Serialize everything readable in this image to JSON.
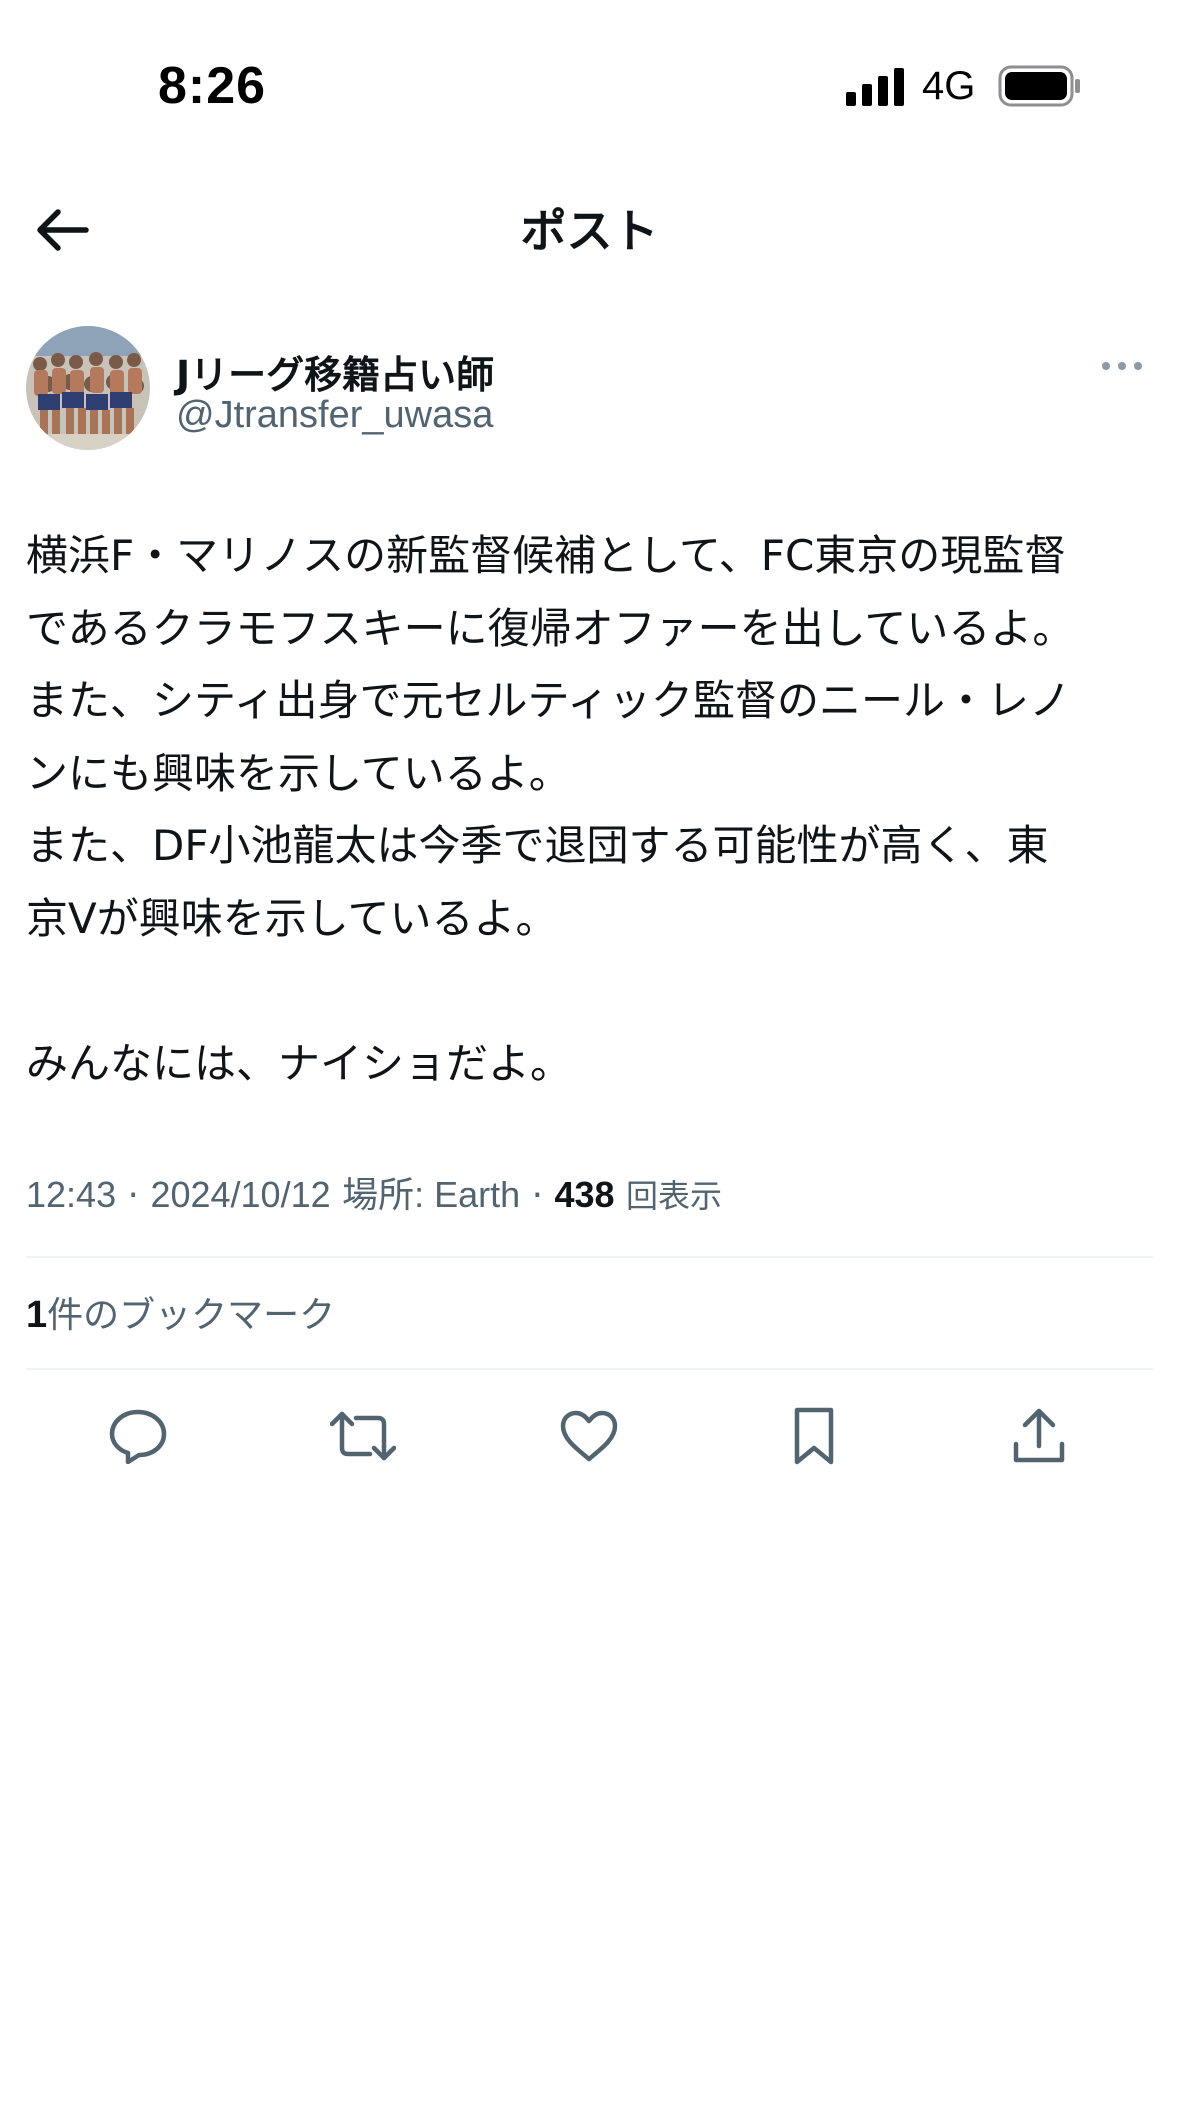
{
  "status_bar": {
    "time": "8:26",
    "network": "4G"
  },
  "header": {
    "title": "ポスト"
  },
  "author": {
    "display_name": "Jリーグ移籍占い師",
    "handle": "@Jtransfer_uwasa"
  },
  "post": {
    "lines": [
      "横浜F・マリノスの新監督候補として、FC東京の現監督",
      "であるクラモフスキーに復帰オファーを出しているよ。",
      "また、シティ出身で元セルティック監督のニール・レノ",
      "ンにも興味を示しているよ。",
      "また、DF小池龍太は今季で退団する可能性が高く、東",
      "京Vが興味を示しているよ。",
      "",
      "みんなには、ナイショだよ。"
    ]
  },
  "meta": {
    "time": "12:43",
    "separator": " · ",
    "date": "2024/10/12",
    "location": "場所: Earth",
    "views_count": "438",
    "views_label": "回表示"
  },
  "bookmarks": {
    "count": "1",
    "label": "件のブックマーク"
  },
  "actions": {
    "icons": [
      "reply-icon",
      "retweet-icon",
      "like-icon",
      "bookmark-icon",
      "share-icon"
    ]
  },
  "colors": {
    "text_primary": "#0f1419",
    "text_secondary": "#536471",
    "divider": "#eff3f4"
  }
}
